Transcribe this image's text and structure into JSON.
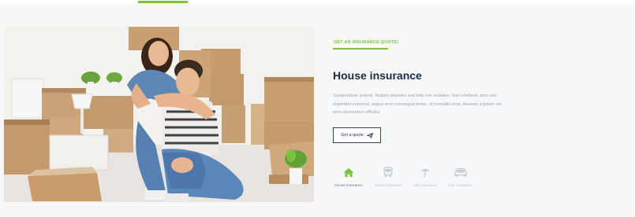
{
  "section": {
    "eyebrow": "GET AN INSURANCE QUOTE!",
    "title": "House insurance",
    "description": "Suspendisse potenti. Nullam pharetra sed felis non sodales. Nam eleifend, arcu sed imperdiet euismod, augue eros consequat tortor, ut convallis eros. Aenean a ipsum vel eros elementum efficitur.",
    "quote_button": {
      "label": "Get a quote",
      "icon": "paper-plane-icon"
    }
  },
  "insurance_tabs": [
    {
      "label": "House insurance",
      "icon": "house-icon",
      "active": true
    },
    {
      "label": "Travel insurance",
      "icon": "bus-icon",
      "active": false
    },
    {
      "label": "Life insurance",
      "icon": "umbrella-icon",
      "active": false
    },
    {
      "label": "Car insurance",
      "icon": "car-icon",
      "active": false
    }
  ],
  "colors": {
    "accent": "#7cc242",
    "heading": "#1d2a44",
    "muted": "#9aa3ad",
    "inactive_icon": "#c4cad1",
    "background": "#f7f8f9"
  }
}
